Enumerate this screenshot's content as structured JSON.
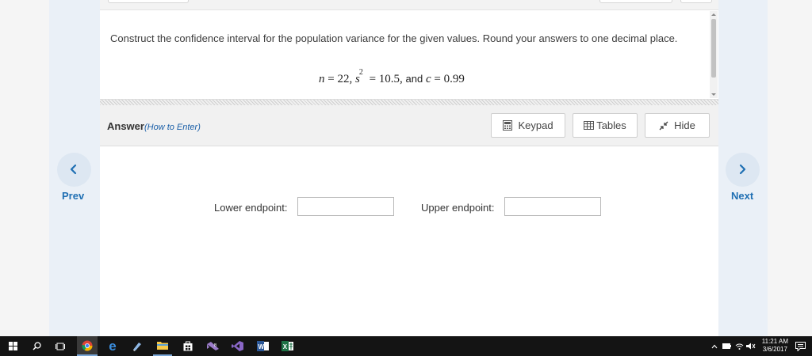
{
  "question": {
    "text": "Construct the confidence interval for the population variance for the given values. Round your answers to one decimal place.",
    "formula": {
      "n_var": "n",
      "n_val": "= 22,",
      "s_var": "s",
      "s_exp": "2",
      "s_val": "= 10.5,",
      "and_text": "and",
      "c_var": "c",
      "c_val": "= 0.99"
    }
  },
  "answer_bar": {
    "title": "Answer",
    "how_to": "(How to Enter)",
    "keypad_label": "Keypad",
    "tables_label": "Tables",
    "hide_label": "Hide"
  },
  "nav": {
    "prev_label": "Prev",
    "next_label": "Next"
  },
  "fields": {
    "lower_label": "Lower endpoint:",
    "lower_value": "",
    "upper_label": "Upper endpoint:",
    "upper_value": ""
  },
  "taskbar": {
    "time": "11:21 AM",
    "date": "3/6/2017",
    "apps": [
      "windows-start",
      "search",
      "task-view",
      "chrome",
      "edge",
      "paint",
      "file-explorer",
      "store",
      "visual-studio-blend",
      "visual-studio",
      "word",
      "excel"
    ]
  },
  "colors": {
    "accent": "#1f6fb3",
    "nav_circle": "#dde7f2",
    "taskbar": "#141414"
  }
}
